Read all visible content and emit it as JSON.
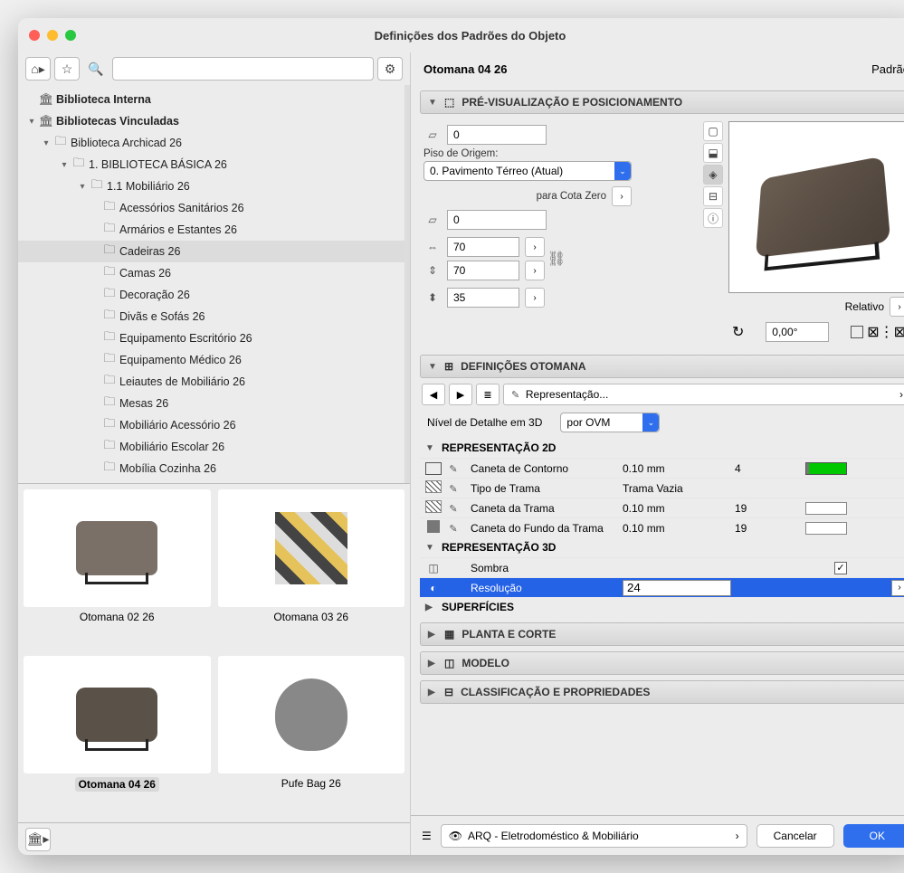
{
  "window": {
    "title": "Definições dos Padrões do Objeto"
  },
  "tree": {
    "root1": "Biblioteca Interna",
    "root2": "Bibliotecas Vinculadas",
    "lib": "Biblioteca Archicad 26",
    "basic": "1. BIBLIOTECA BÁSICA 26",
    "mob": "1.1 Mobiliário 26",
    "items": [
      "Acessórios Sanitários 26",
      "Armários e Estantes 26",
      "Cadeiras 26",
      "Camas 26",
      "Decoração 26",
      "Divãs e Sofás 26",
      "Equipamento Escritório 26",
      "Equipamento Médico 26",
      "Leiautes de Mobiliário 26",
      "Mesas 26",
      "Mobiliário Acessório 26",
      "Mobiliário Escolar 26",
      "Mobília Cozinha 26"
    ],
    "selected_index": 2
  },
  "thumbs": [
    {
      "name": "Otomana 02 26"
    },
    {
      "name": "Otomana 03 26"
    },
    {
      "name": "Otomana 04 26",
      "selected": true
    },
    {
      "name": "Pufe Bag 26"
    }
  ],
  "object": {
    "name": "Otomana 04 26",
    "mode": "Padrão"
  },
  "sections": {
    "preview": "PRÉ-VISUALIZAÇÃO E POSICIONAMENTO",
    "defs": "DEFINIÇÕES OTOMANA",
    "planta": "PLANTA E CORTE",
    "modelo": "MODELO",
    "class": "CLASSIFICAÇÃO E PROPRIEDADES"
  },
  "preview": {
    "story_label": "Piso de Origem:",
    "story_value": "0. Pavimento Térreo (Atual)",
    "cota_label": "para Cota Zero",
    "elev1": "0",
    "elev2": "0",
    "dimx": "70",
    "dimy": "70",
    "dimz": "35",
    "relative": "Relativo",
    "angle": "0,00°"
  },
  "defs": {
    "repr_label": "Representação...",
    "lod_label": "Nível de Detalhe em 3D",
    "lod_value": "por OVM",
    "groups": {
      "g2d": "REPRESENTAÇÃO 2D",
      "g3d": "REPRESENTAÇÃO 3D",
      "surf": "SUPERFÍCIES"
    },
    "rows2d": [
      {
        "name": "Caneta de Contorno",
        "val": "0.10 mm",
        "num": "4",
        "swatch": "green"
      },
      {
        "name": "Tipo de Trama",
        "val": "Trama Vazia",
        "num": "",
        "swatch": ""
      },
      {
        "name": "Caneta da Trama",
        "val": "0.10 mm",
        "num": "19",
        "swatch": "white"
      },
      {
        "name": "Caneta do Fundo da Trama",
        "val": "0.10 mm",
        "num": "19",
        "swatch": "white"
      }
    ],
    "rows3d": {
      "shadow": "Sombra",
      "shadow_on": true,
      "res_label": "Resolução",
      "res_value": "24"
    }
  },
  "footer": {
    "layer": "ARQ - Eletrodoméstico & Mobiliário",
    "cancel": "Cancelar",
    "ok": "OK"
  }
}
